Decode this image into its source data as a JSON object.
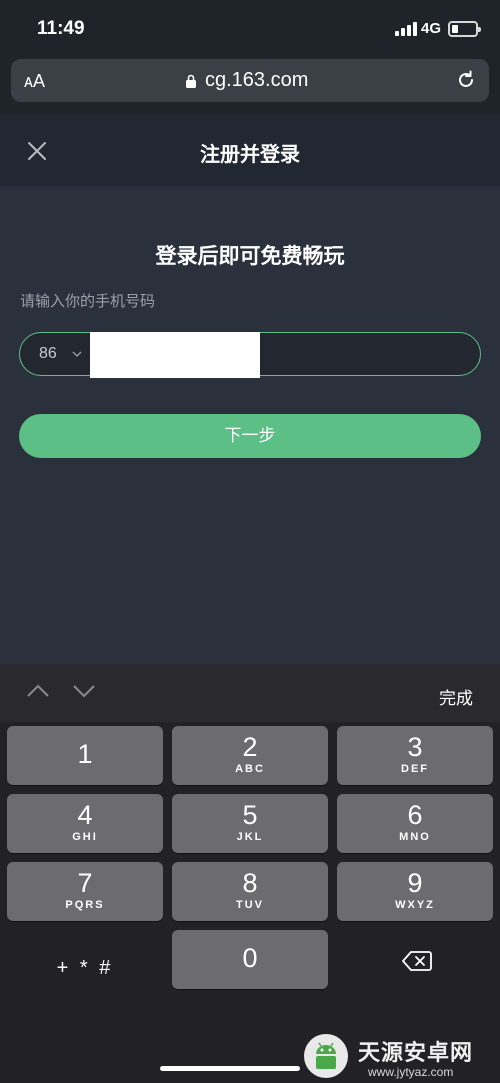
{
  "status_bar": {
    "time": "11:49",
    "network": "4G",
    "battery_level": 0.25
  },
  "browser": {
    "text_size": "AA",
    "url": "cg.163.com"
  },
  "header": {
    "title": "注册并登录"
  },
  "main": {
    "heading": "登录后即可免费畅玩",
    "prompt": "请输入你的手机号码",
    "country_code": "86",
    "next_label": "下一步"
  },
  "keyboard": {
    "done_label": "完成",
    "keys": [
      {
        "num": "1",
        "letters": ""
      },
      {
        "num": "2",
        "letters": "ABC"
      },
      {
        "num": "3",
        "letters": "DEF"
      },
      {
        "num": "4",
        "letters": "GHI"
      },
      {
        "num": "5",
        "letters": "JKL"
      },
      {
        "num": "6",
        "letters": "MNO"
      },
      {
        "num": "7",
        "letters": "PQRS"
      },
      {
        "num": "8",
        "letters": "TUV"
      },
      {
        "num": "9",
        "letters": "WXYZ"
      },
      {
        "num": "0",
        "letters": ""
      }
    ],
    "symbols_label": "+ * #"
  },
  "watermark": {
    "title": "天源安卓网",
    "url": "www.jytyaz.com"
  },
  "colors": {
    "accent": "#5bbf86",
    "background": "#2b313c",
    "header": "#222831",
    "key": "#6b6b70"
  }
}
